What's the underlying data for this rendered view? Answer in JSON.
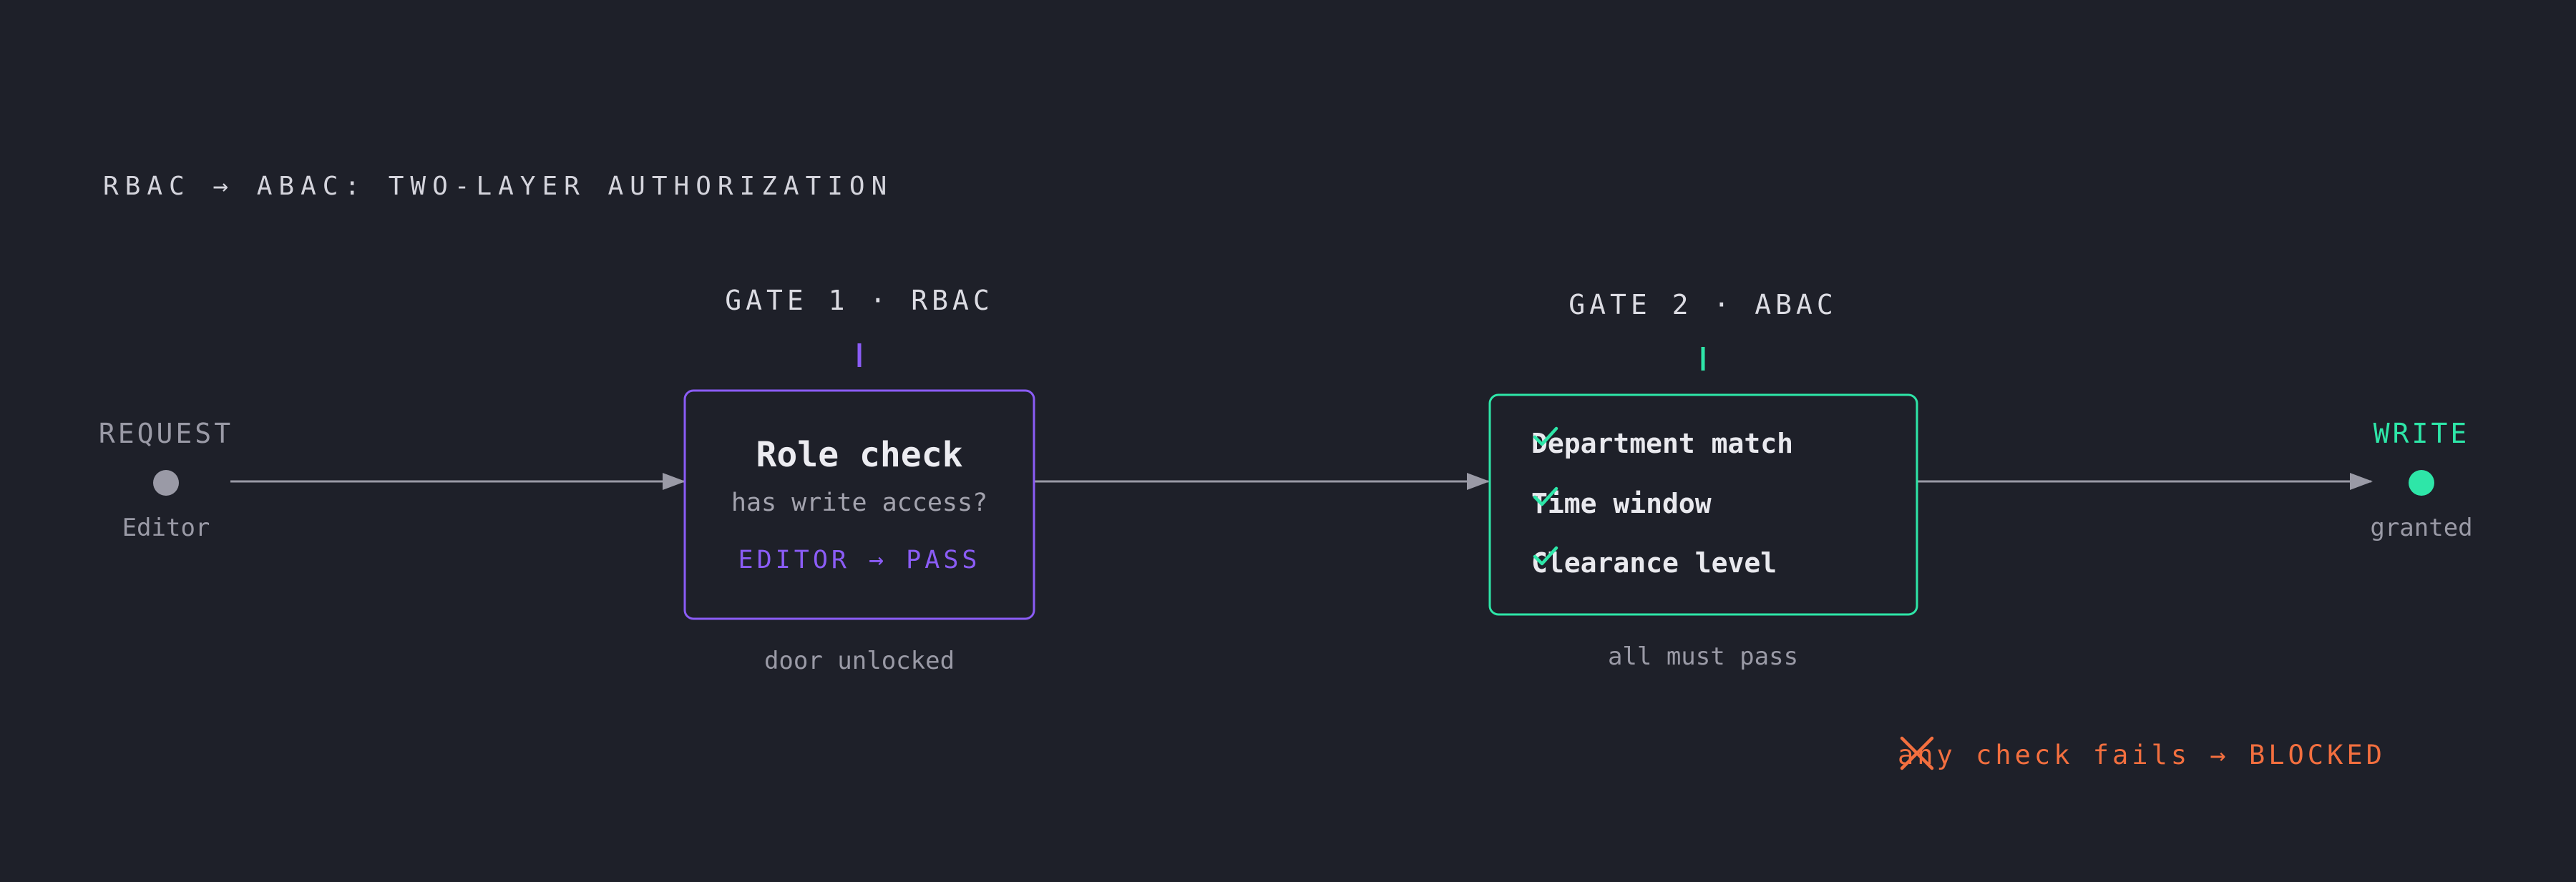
{
  "title": "RBAC → ABAC: TWO-LAYER AUTHORIZATION",
  "colors": {
    "background": "#1e2029",
    "neutral": "#9a9aa6",
    "rbac_accent": "#8b5cf6",
    "abac_accent": "#2ee6a8",
    "blocked": "#f36f3f"
  },
  "request": {
    "label": "REQUEST",
    "sublabel": "Editor"
  },
  "gate1": {
    "label": "GATE 1 · RBAC",
    "heading": "Role check",
    "question": "has write access?",
    "result": "EDITOR → PASS",
    "caption": "door unlocked"
  },
  "gate2": {
    "label": "GATE 2 · ABAC",
    "checks": [
      {
        "label": "Department match",
        "icon": "checkmark-icon"
      },
      {
        "label": "Time window",
        "icon": "checkmark-icon"
      },
      {
        "label": "Clearance level",
        "icon": "checkmark-icon"
      }
    ],
    "caption": "all must pass"
  },
  "write": {
    "label": "WRITE",
    "sublabel": "granted"
  },
  "blocked": {
    "icon": "cross-icon",
    "text": "any check fails → BLOCKED"
  }
}
